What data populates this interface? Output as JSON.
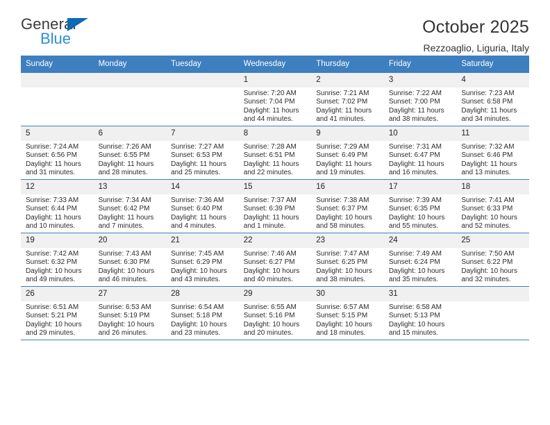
{
  "brand": {
    "name_top": "General",
    "name_bottom": "Blue",
    "triangle_color": "#0d6ab5",
    "blue_color": "#2e8fd6"
  },
  "header": {
    "title": "October 2025",
    "subtitle": "Rezzoaglio, Liguria, Italy"
  },
  "theme": {
    "header_bg": "#3d7fbf",
    "daynum_bg": "#f0f0f0",
    "row_border": "#3d7fbf",
    "text": "#2b2b2b"
  },
  "labels": {
    "sunrise": "Sunrise:",
    "sunset": "Sunset:",
    "daylight": "Daylight:"
  },
  "weekday_headers": [
    "Sunday",
    "Monday",
    "Tuesday",
    "Wednesday",
    "Thursday",
    "Friday",
    "Saturday"
  ],
  "weeks": [
    [
      {
        "day": "",
        "empty": true
      },
      {
        "day": "",
        "empty": true
      },
      {
        "day": "",
        "empty": true
      },
      {
        "day": "1",
        "sunrise": "Sunrise: 7:20 AM",
        "sunset": "Sunset: 7:04 PM",
        "daylight": "Daylight: 11 hours and 44 minutes."
      },
      {
        "day": "2",
        "sunrise": "Sunrise: 7:21 AM",
        "sunset": "Sunset: 7:02 PM",
        "daylight": "Daylight: 11 hours and 41 minutes."
      },
      {
        "day": "3",
        "sunrise": "Sunrise: 7:22 AM",
        "sunset": "Sunset: 7:00 PM",
        "daylight": "Daylight: 11 hours and 38 minutes."
      },
      {
        "day": "4",
        "sunrise": "Sunrise: 7:23 AM",
        "sunset": "Sunset: 6:58 PM",
        "daylight": "Daylight: 11 hours and 34 minutes."
      }
    ],
    [
      {
        "day": "5",
        "sunrise": "Sunrise: 7:24 AM",
        "sunset": "Sunset: 6:56 PM",
        "daylight": "Daylight: 11 hours and 31 minutes."
      },
      {
        "day": "6",
        "sunrise": "Sunrise: 7:26 AM",
        "sunset": "Sunset: 6:55 PM",
        "daylight": "Daylight: 11 hours and 28 minutes."
      },
      {
        "day": "7",
        "sunrise": "Sunrise: 7:27 AM",
        "sunset": "Sunset: 6:53 PM",
        "daylight": "Daylight: 11 hours and 25 minutes."
      },
      {
        "day": "8",
        "sunrise": "Sunrise: 7:28 AM",
        "sunset": "Sunset: 6:51 PM",
        "daylight": "Daylight: 11 hours and 22 minutes."
      },
      {
        "day": "9",
        "sunrise": "Sunrise: 7:29 AM",
        "sunset": "Sunset: 6:49 PM",
        "daylight": "Daylight: 11 hours and 19 minutes."
      },
      {
        "day": "10",
        "sunrise": "Sunrise: 7:31 AM",
        "sunset": "Sunset: 6:47 PM",
        "daylight": "Daylight: 11 hours and 16 minutes."
      },
      {
        "day": "11",
        "sunrise": "Sunrise: 7:32 AM",
        "sunset": "Sunset: 6:46 PM",
        "daylight": "Daylight: 11 hours and 13 minutes."
      }
    ],
    [
      {
        "day": "12",
        "sunrise": "Sunrise: 7:33 AM",
        "sunset": "Sunset: 6:44 PM",
        "daylight": "Daylight: 11 hours and 10 minutes."
      },
      {
        "day": "13",
        "sunrise": "Sunrise: 7:34 AM",
        "sunset": "Sunset: 6:42 PM",
        "daylight": "Daylight: 11 hours and 7 minutes."
      },
      {
        "day": "14",
        "sunrise": "Sunrise: 7:36 AM",
        "sunset": "Sunset: 6:40 PM",
        "daylight": "Daylight: 11 hours and 4 minutes."
      },
      {
        "day": "15",
        "sunrise": "Sunrise: 7:37 AM",
        "sunset": "Sunset: 6:39 PM",
        "daylight": "Daylight: 11 hours and 1 minute."
      },
      {
        "day": "16",
        "sunrise": "Sunrise: 7:38 AM",
        "sunset": "Sunset: 6:37 PM",
        "daylight": "Daylight: 10 hours and 58 minutes."
      },
      {
        "day": "17",
        "sunrise": "Sunrise: 7:39 AM",
        "sunset": "Sunset: 6:35 PM",
        "daylight": "Daylight: 10 hours and 55 minutes."
      },
      {
        "day": "18",
        "sunrise": "Sunrise: 7:41 AM",
        "sunset": "Sunset: 6:33 PM",
        "daylight": "Daylight: 10 hours and 52 minutes."
      }
    ],
    [
      {
        "day": "19",
        "sunrise": "Sunrise: 7:42 AM",
        "sunset": "Sunset: 6:32 PM",
        "daylight": "Daylight: 10 hours and 49 minutes."
      },
      {
        "day": "20",
        "sunrise": "Sunrise: 7:43 AM",
        "sunset": "Sunset: 6:30 PM",
        "daylight": "Daylight: 10 hours and 46 minutes."
      },
      {
        "day": "21",
        "sunrise": "Sunrise: 7:45 AM",
        "sunset": "Sunset: 6:29 PM",
        "daylight": "Daylight: 10 hours and 43 minutes."
      },
      {
        "day": "22",
        "sunrise": "Sunrise: 7:46 AM",
        "sunset": "Sunset: 6:27 PM",
        "daylight": "Daylight: 10 hours and 40 minutes."
      },
      {
        "day": "23",
        "sunrise": "Sunrise: 7:47 AM",
        "sunset": "Sunset: 6:25 PM",
        "daylight": "Daylight: 10 hours and 38 minutes."
      },
      {
        "day": "24",
        "sunrise": "Sunrise: 7:49 AM",
        "sunset": "Sunset: 6:24 PM",
        "daylight": "Daylight: 10 hours and 35 minutes."
      },
      {
        "day": "25",
        "sunrise": "Sunrise: 7:50 AM",
        "sunset": "Sunset: 6:22 PM",
        "daylight": "Daylight: 10 hours and 32 minutes."
      }
    ],
    [
      {
        "day": "26",
        "sunrise": "Sunrise: 6:51 AM",
        "sunset": "Sunset: 5:21 PM",
        "daylight": "Daylight: 10 hours and 29 minutes."
      },
      {
        "day": "27",
        "sunrise": "Sunrise: 6:53 AM",
        "sunset": "Sunset: 5:19 PM",
        "daylight": "Daylight: 10 hours and 26 minutes."
      },
      {
        "day": "28",
        "sunrise": "Sunrise: 6:54 AM",
        "sunset": "Sunset: 5:18 PM",
        "daylight": "Daylight: 10 hours and 23 minutes."
      },
      {
        "day": "29",
        "sunrise": "Sunrise: 6:55 AM",
        "sunset": "Sunset: 5:16 PM",
        "daylight": "Daylight: 10 hours and 20 minutes."
      },
      {
        "day": "30",
        "sunrise": "Sunrise: 6:57 AM",
        "sunset": "Sunset: 5:15 PM",
        "daylight": "Daylight: 10 hours and 18 minutes."
      },
      {
        "day": "31",
        "sunrise": "Sunrise: 6:58 AM",
        "sunset": "Sunset: 5:13 PM",
        "daylight": "Daylight: 10 hours and 15 minutes."
      },
      {
        "day": "",
        "empty": true
      }
    ]
  ]
}
